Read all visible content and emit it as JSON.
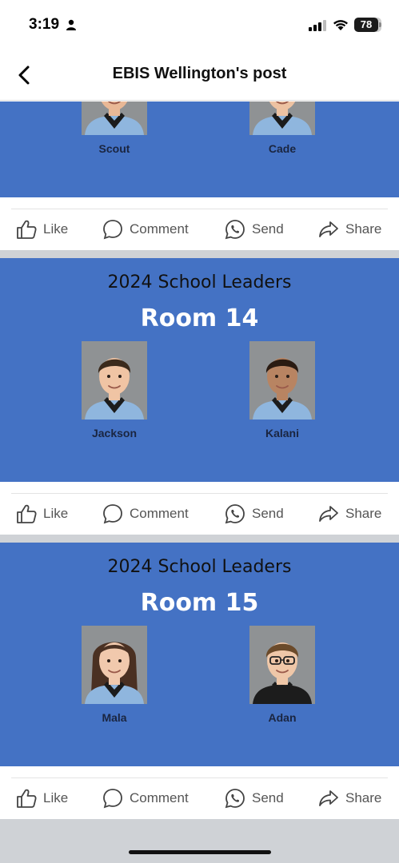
{
  "status_bar": {
    "time": "3:19",
    "battery": "78",
    "icons": [
      "person-icon",
      "cellular-signal-icon",
      "wifi-icon",
      "battery-icon"
    ]
  },
  "header": {
    "title": "EBIS Wellington's post",
    "back_icon": "chevron-left-icon"
  },
  "posts": [
    {
      "heading": "",
      "room": "",
      "students": [
        {
          "name": "Scout",
          "hair": "#b07a45",
          "skin": "#e9b896"
        },
        {
          "name": "Cade",
          "hair": "#c08a55",
          "skin": "#edc2a2"
        }
      ]
    },
    {
      "heading": "2024 School Leaders",
      "room": "Room 14",
      "students": [
        {
          "name": "Jackson",
          "hair": "#3b2a1c",
          "skin": "#f0c4a4"
        },
        {
          "name": "Kalani",
          "hair": "#2a1b12",
          "skin": "#b88462"
        }
      ]
    },
    {
      "heading": "2024 School Leaders",
      "room": "Room 15",
      "students": [
        {
          "name": "Mala",
          "hair": "#4a3022",
          "skin": "#f1c9ad"
        },
        {
          "name": "Adan",
          "hair": "#6b4a2a",
          "skin": "#efc7a8"
        }
      ]
    }
  ],
  "actions": {
    "like": "Like",
    "comment": "Comment",
    "send": "Send",
    "share": "Share"
  },
  "colors": {
    "post_background": "#4472c4",
    "uniform_light_blue": "#8fb6de",
    "uniform_collar": "#1c1c1c"
  }
}
